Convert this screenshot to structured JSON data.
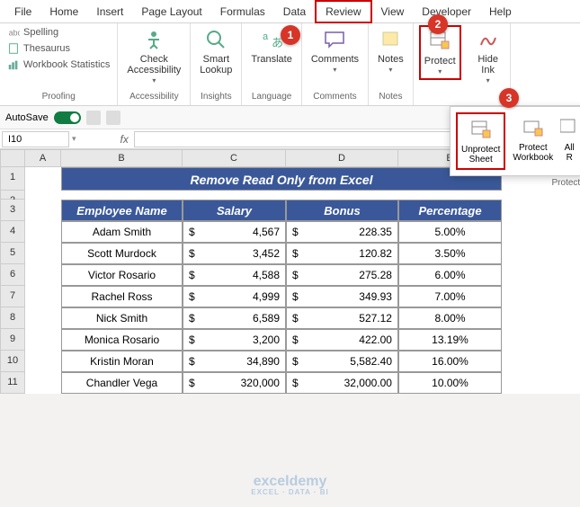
{
  "ribbon": {
    "tabs": [
      "File",
      "Home",
      "Insert",
      "Page Layout",
      "Formulas",
      "Data",
      "Review",
      "View",
      "Developer",
      "Help"
    ],
    "active_tab": "Review",
    "groups": {
      "proofing": {
        "label": "Proofing",
        "items": [
          "Spelling",
          "Thesaurus",
          "Workbook Statistics"
        ]
      },
      "accessibility": {
        "label": "Accessibility",
        "item": "Check\nAccessibility"
      },
      "insights": {
        "label": "Insights",
        "item": "Smart\nLookup"
      },
      "language": {
        "label": "Language",
        "item": "Translate"
      },
      "comments": {
        "label": "Comments",
        "item": "Comments"
      },
      "notes": {
        "label": "Notes",
        "item": "Notes"
      },
      "protect": {
        "label": "",
        "item": "Protect"
      },
      "ink": {
        "label": "",
        "item": "Hide\nInk"
      }
    }
  },
  "autosave": {
    "label": "AutoSave"
  },
  "namebox": {
    "value": "I10",
    "fx": "fx"
  },
  "columns": [
    "A",
    "B",
    "C",
    "D",
    "E"
  ],
  "row_numbers": [
    "1",
    "2",
    "3",
    "4",
    "5",
    "6",
    "7",
    "8",
    "9",
    "10",
    "11"
  ],
  "chart_data": {
    "type": "table",
    "title": "Remove Read Only from Excel",
    "headers": [
      "Employee Name",
      "Salary",
      "Bonus",
      "Percentage"
    ],
    "rows": [
      {
        "name": "Adam Smith",
        "salary": "4,567",
        "bonus": "228.35",
        "pct": "5.00%"
      },
      {
        "name": "Scott Murdock",
        "salary": "3,452",
        "bonus": "120.82",
        "pct": "3.50%"
      },
      {
        "name": "Victor Rosario",
        "salary": "4,588",
        "bonus": "275.28",
        "pct": "6.00%"
      },
      {
        "name": "Rachel Ross",
        "salary": "4,999",
        "bonus": "349.93",
        "pct": "7.00%"
      },
      {
        "name": "Nick Smith",
        "salary": "6,589",
        "bonus": "527.12",
        "pct": "8.00%"
      },
      {
        "name": "Monica Rosario",
        "salary": "3,200",
        "bonus": "422.00",
        "pct": "13.19%"
      },
      {
        "name": "Kristin Moran",
        "salary": "34,890",
        "bonus": "5,582.40",
        "pct": "16.00%"
      },
      {
        "name": "Chandler Vega",
        "salary": "320,000",
        "bonus": "32,000.00",
        "pct": "10.00%"
      }
    ]
  },
  "currency": "$",
  "dropdown": {
    "items": [
      "Unprotect\nSheet",
      "Protect\nWorkbook",
      "All\nR"
    ],
    "group_label": "Protect"
  },
  "callouts": {
    "1": "1",
    "2": "2",
    "3": "3"
  },
  "watermark": {
    "main": "exceldemy",
    "sub": "EXCEL · DATA · BI"
  }
}
